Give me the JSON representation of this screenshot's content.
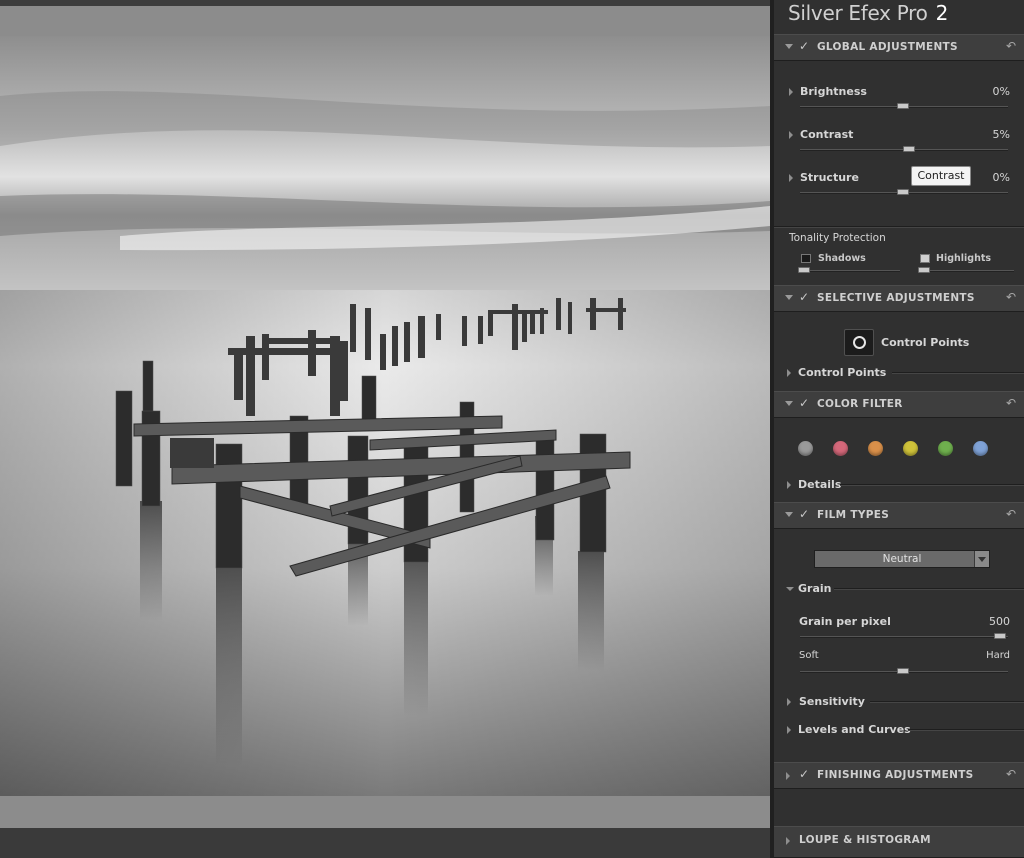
{
  "app": {
    "title": "Silver Efex Pro",
    "version": "2"
  },
  "global_adjustments": {
    "header": "GLOBAL ADJUSTMENTS",
    "brightness": {
      "label": "Brightness",
      "value": "0%",
      "level": 0
    },
    "contrast": {
      "label": "Contrast",
      "value": "5%",
      "level": 5
    },
    "structure": {
      "label": "Structure",
      "value": "0%",
      "level": 0
    },
    "tooltip": "Contrast",
    "tonality_protection": {
      "label": "Tonality Protection",
      "shadows": "Shadows",
      "highlights": "Highlights"
    }
  },
  "selective_adjustments": {
    "header": "SELECTIVE ADJUSTMENTS",
    "button_label": "Control Points",
    "row_label": "Control Points"
  },
  "color_filter": {
    "header": "COLOR FILTER",
    "swatches": [
      "#9a9a9a",
      "#d4687a",
      "#d9904a",
      "#cfc23a",
      "#6fb04e",
      "#7fa2d6"
    ],
    "details": "Details"
  },
  "film_types": {
    "header": "FILM TYPES",
    "selected": "Neutral",
    "grain": {
      "label": "Grain",
      "per_pixel_label": "Grain per pixel",
      "per_pixel_value": "500",
      "soft": "Soft",
      "hard": "Hard"
    },
    "sensitivity": "Sensitivity",
    "levels_curves": "Levels and Curves"
  },
  "finishing_adjustments": {
    "header": "FINISHING ADJUSTMENTS"
  },
  "loupe_histogram": {
    "header": "LOUPE & HISTOGRAM"
  },
  "colors": {
    "panel": "#303030",
    "section_header": "#3e3e3e",
    "frame": "#8c8c8c"
  },
  "icons": {
    "check": "check-icon",
    "undo": "undo-icon",
    "triangle": "triangle-icon"
  }
}
